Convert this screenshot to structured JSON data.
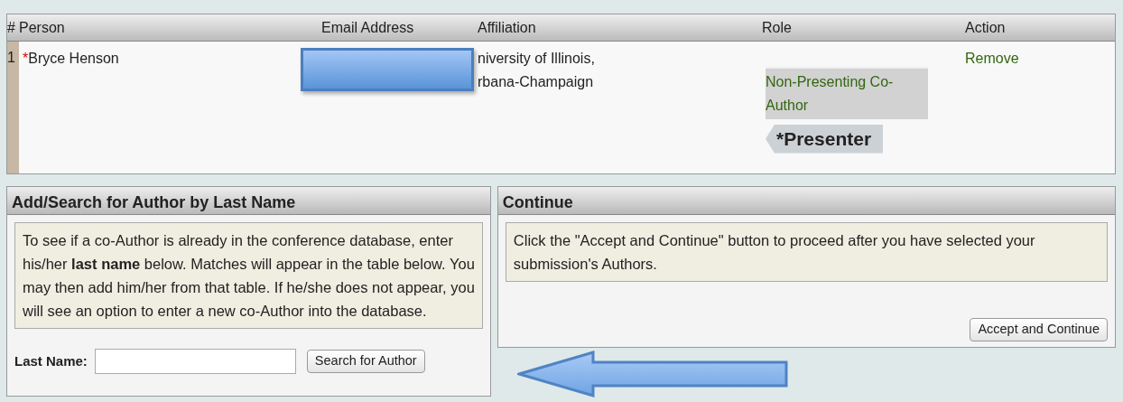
{
  "authors_table": {
    "columns": [
      "#",
      "Person",
      "Email Address",
      "Affiliation",
      "Role",
      "Action"
    ],
    "rows": [
      {
        "number": "1",
        "required_mark": "*",
        "person": "Bryce Henson",
        "affiliation_lines": [
          "niversity of Illinois,",
          "rbana-Champaign"
        ],
        "roles": [
          {
            "label": "Non-Presenting Co-Author",
            "selected": false
          },
          {
            "label": "*Presenter",
            "selected": true
          }
        ],
        "action": "Remove"
      }
    ]
  },
  "search_panel": {
    "title": "Add/Search for Author by Last Name",
    "info": "To see if a co-Author is already in the conference database, enter his/her **last name** below. Matches will appear in the table below. You may then add him/her from that table. If he/she does not appear, you will see an option to enter a new co-Author into the database.",
    "field_label": "Last Name:",
    "button": "Search for Author"
  },
  "continue_panel": {
    "title": "Continue",
    "info": "Click the \"Accept and Continue\" button to proceed after you have selected your submission's Authors.",
    "button": "Accept and Continue"
  }
}
